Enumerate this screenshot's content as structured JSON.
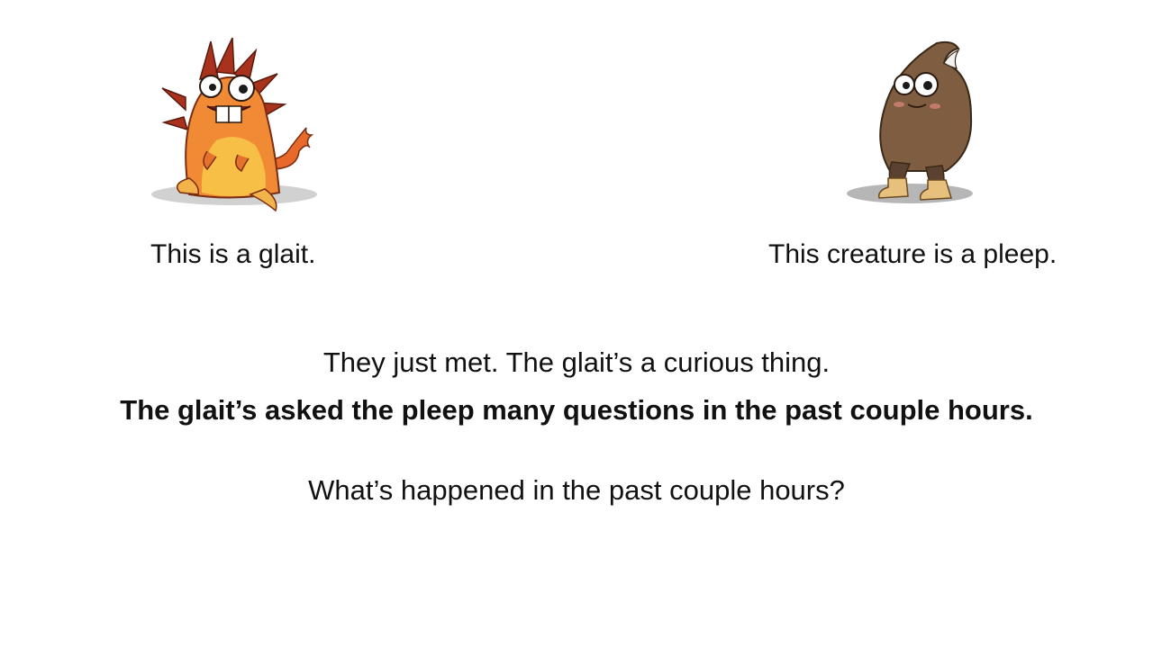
{
  "slide": {
    "glait_caption": "This is a glait.",
    "pleep_caption": "This creature is a pleep.",
    "line1": "They just met. The glait’s a curious thing.",
    "line2": "The glait’s asked the pleep many questions in the past couple hours.",
    "question": "What’s happened in the past couple hours?"
  },
  "illustrations": {
    "glait": {
      "icon": "orange-spiky-monster-illustration",
      "colors": {
        "body": "#f2913a",
        "belly": "#f7c04a",
        "spikes": "#b2311e"
      }
    },
    "pleep": {
      "icon": "brown-hooded-creature-illustration",
      "colors": {
        "body": "#7a5a3e",
        "legs": "#5e4431",
        "boots": "#e5c27f"
      }
    }
  }
}
